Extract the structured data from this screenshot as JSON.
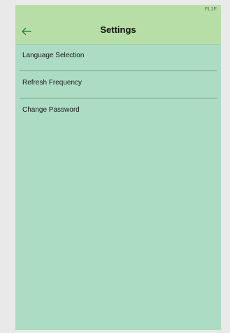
{
  "status_bar": {
    "code": "FL1F"
  },
  "app_bar": {
    "title": "Settings",
    "back_icon": "arrow-left-icon"
  },
  "settings": {
    "items": [
      {
        "label": "Language Selection"
      },
      {
        "label": "Refresh Frequency"
      },
      {
        "label": "Change Password"
      }
    ]
  },
  "colors": {
    "app_bar_background": "#b7dea6",
    "content_background": "#addcc4",
    "back_arrow": "#2d8a3e"
  }
}
